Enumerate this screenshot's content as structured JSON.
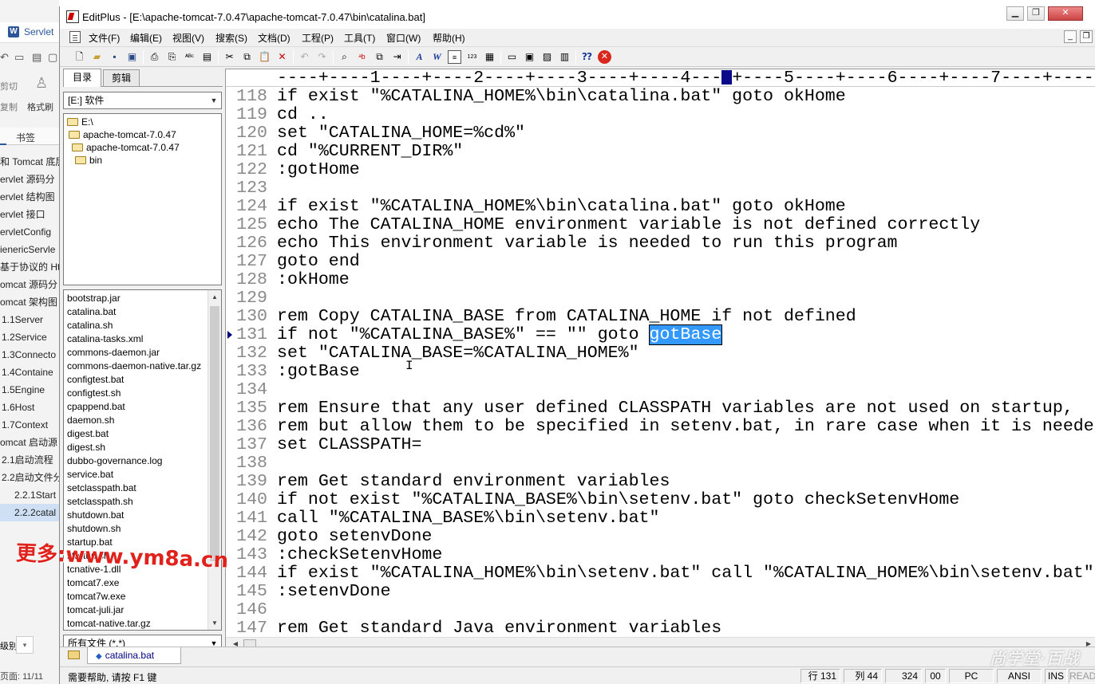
{
  "background_app": {
    "tab_label": "Servlet",
    "ribbon": {
      "cut": "剪切",
      "copy": "复制",
      "format_painter": "格式刷"
    },
    "bookmark_tab": "书签",
    "nav_items": [
      "和 Tomcat 底层",
      "ervlet 源码分",
      "ervlet 结构图",
      "ervlet 接口",
      "ervletConfig",
      "ienericServle",
      "基于协议的 Ht",
      "omcat 源码分",
      "omcat 架构图",
      "1.1Server",
      "1.2Service",
      "1.3Connecto",
      "1.4Containe",
      "1.5Engine",
      "1.6Host",
      "1.7Context",
      "omcat 启动源",
      "2.1启动流程",
      "2.2启动文件分",
      "2.2.1Start",
      "2.2.2catal"
    ],
    "level_label": "级别",
    "page_label": "页面: 11/11"
  },
  "window": {
    "title": "EditPlus - [E:\\apache-tomcat-7.0.47\\apache-tomcat-7.0.47\\bin\\catalina.bat]"
  },
  "menu": [
    "文件(F)",
    "编辑(E)",
    "视图(V)",
    "搜索(S)",
    "文档(D)",
    "工程(P)",
    "工具(T)",
    "窗口(W)",
    "帮助(H)"
  ],
  "sidebar": {
    "tabs": [
      "目录",
      "剪辑"
    ],
    "drive": "[E:] 软件",
    "tree": [
      "E:\\",
      "apache-tomcat-7.0.47",
      "apache-tomcat-7.0.47",
      "bin"
    ],
    "files": [
      "bootstrap.jar",
      "catalina.bat",
      "catalina.sh",
      "catalina-tasks.xml",
      "commons-daemon.jar",
      "commons-daemon-native.tar.gz",
      "configtest.bat",
      "configtest.sh",
      "cpappend.bat",
      "daemon.sh",
      "digest.bat",
      "digest.sh",
      "dubbo-governance.log",
      "service.bat",
      "setclasspath.bat",
      "setclasspath.sh",
      "shutdown.bat",
      "shutdown.sh",
      "startup.bat",
      "startup.sh",
      "tcnative-1.dll",
      "tomcat7.exe",
      "tomcat7w.exe",
      "tomcat-juli.jar",
      "tomcat-native.tar.gz"
    ],
    "filter": "所有文件 (*.*)"
  },
  "ruler": "----+----1----+----2----+----3----+----4---",
  "ruler_tail": "+----5----+----6----+----7----+----",
  "code": {
    "current_line": 131,
    "selected_text": "gotBase",
    "lines": [
      {
        "n": "118",
        "t": "if exist \"%CATALINA_HOME%\\bin\\catalina.bat\" goto okHome"
      },
      {
        "n": "119",
        "t": "cd .."
      },
      {
        "n": "120",
        "t": "set \"CATALINA_HOME=%cd%\""
      },
      {
        "n": "121",
        "t": "cd \"%CURRENT_DIR%\""
      },
      {
        "n": "122",
        "t": ":gotHome"
      },
      {
        "n": "123",
        "t": ""
      },
      {
        "n": "124",
        "t": "if exist \"%CATALINA_HOME%\\bin\\catalina.bat\" goto okHome"
      },
      {
        "n": "125",
        "t": "echo The CATALINA_HOME environment variable is not defined correctly"
      },
      {
        "n": "126",
        "t": "echo This environment variable is needed to run this program"
      },
      {
        "n": "127",
        "t": "goto end"
      },
      {
        "n": "128",
        "t": ":okHome"
      },
      {
        "n": "129",
        "t": ""
      },
      {
        "n": "130",
        "t": "rem Copy CATALINA_BASE from CATALINA_HOME if not defined"
      },
      {
        "n": "131",
        "t": "if not \"%CATALINA_BASE%\" == \"\" goto ",
        "sel": "gotBase"
      },
      {
        "n": "132",
        "t": "set \"CATALINA_BASE=%CATALINA_HOME%\""
      },
      {
        "n": "133",
        "t": ":gotBase"
      },
      {
        "n": "134",
        "t": ""
      },
      {
        "n": "135",
        "t": "rem Ensure that any user defined CLASSPATH variables are not used on startup,"
      },
      {
        "n": "136",
        "t": "rem but allow them to be specified in setenv.bat, in rare case when it is needed."
      },
      {
        "n": "137",
        "t": "set CLASSPATH="
      },
      {
        "n": "138",
        "t": ""
      },
      {
        "n": "139",
        "t": "rem Get standard environment variables"
      },
      {
        "n": "140",
        "t": "if not exist \"%CATALINA_BASE%\\bin\\setenv.bat\" goto checkSetenvHome"
      },
      {
        "n": "141",
        "t": "call \"%CATALINA_BASE%\\bin\\setenv.bat\""
      },
      {
        "n": "142",
        "t": "goto setenvDone"
      },
      {
        "n": "143",
        "t": ":checkSetenvHome"
      },
      {
        "n": "144",
        "t": "if exist \"%CATALINA_HOME%\\bin\\setenv.bat\" call \"%CATALINA_HOME%\\bin\\setenv.bat\""
      },
      {
        "n": "145",
        "t": ":setenvDone"
      },
      {
        "n": "146",
        "t": ""
      },
      {
        "n": "147",
        "t": "rem Get standard Java environment variables"
      }
    ]
  },
  "file_tab": "catalina.bat",
  "status": {
    "help": "需要帮助, 请按 F1 键",
    "line": "行 131",
    "col": "列 44",
    "chars": "324",
    "zero": "00",
    "eol": "PC",
    "encoding": "ANSI",
    "ins": "INS",
    "read": "READ"
  },
  "watermark": "更多:www.ym8a.cn",
  "brand": "尚学堂·百战"
}
